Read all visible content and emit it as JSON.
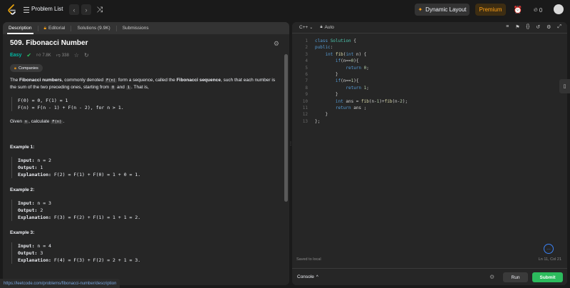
{
  "topbar": {
    "problem_list_label": "Problem List",
    "dynamic_layout_label": "Dynamic Layout",
    "premium_label": "Premium",
    "fire_count": "0"
  },
  "left_tabs": [
    {
      "label": "Description"
    },
    {
      "label": "Editorial"
    },
    {
      "label": "Solutions (9.9K)"
    },
    {
      "label": "Submissions"
    }
  ],
  "problem": {
    "title": "509. Fibonacci Number",
    "difficulty": "Easy",
    "likes": "7.8K",
    "dislikes": "338",
    "companies_label": "Companies",
    "intro_a": "The ",
    "intro_bold1": "Fibonacci numbers",
    "intro_b": ", commonly denoted ",
    "intro_code1": "F(n)",
    "intro_c": " form a sequence, called the ",
    "intro_bold2": "Fibonacci sequence",
    "intro_d": ", such that each number is the sum of the two preceding ones, starting from ",
    "intro_code2": "0",
    "intro_e": " and ",
    "intro_code3": "1",
    "intro_f": ". That is,",
    "formula": "F(0) = 0, F(1) = 1\nF(n) = F(n - 1) + F(n - 2), for n > 1.",
    "given_a": "Given ",
    "given_code1": "n",
    "given_b": ", calculate ",
    "given_code2": "F(n)",
    "given_c": "."
  },
  "examples": [
    {
      "heading": "Example 1:",
      "input": "n = 2",
      "output": "1",
      "explanation": "F(2) = F(1) + F(0) = 1 + 0 = 1."
    },
    {
      "heading": "Example 2:",
      "input": "n = 3",
      "output": "2",
      "explanation": "F(3) = F(2) + F(1) = 1 + 1 = 2."
    },
    {
      "heading": "Example 3:",
      "input": "n = 4",
      "output": "3",
      "explanation": "F(4) = F(3) + F(2) = 2 + 1 = 3."
    }
  ],
  "labels": {
    "input": "Input: ",
    "output": "Output: ",
    "explanation": "Explanation: "
  },
  "status_url": "https://leetcode.com/problems/fibonacci-number/description",
  "editor": {
    "language": "C++",
    "auto_label": "Auto",
    "saved_label": "Saved to local",
    "cursor_position": "Ln 11, Col 21",
    "console_label": "Console",
    "run_label": "Run",
    "submit_label": "Submit"
  },
  "code_lines": [
    "class Solution {",
    "public:",
    "    int fib(int n) {",
    "        if(n==0){",
    "            return 0;",
    "        }",
    "        if(n==1){",
    "            return 1;",
    "        }",
    "        int ans = fib(n-1)+fib(n-2);",
    "        return ans ;",
    "    }",
    "};"
  ],
  "colors": {
    "accent_green": "#2cbb5d",
    "easy": "#00b8a3",
    "premium": "#ffa116"
  }
}
